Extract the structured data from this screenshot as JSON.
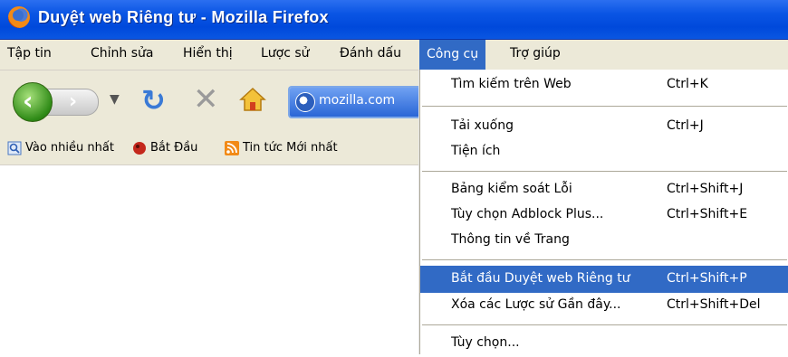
{
  "window": {
    "title": "Duyệt web Riêng tư - Mozilla Firefox"
  },
  "menubar": {
    "items": [
      "Tập tin",
      "Chỉnh sửa",
      "Hiển thị",
      "Lược sử",
      "Đánh dấu",
      "Công cụ",
      "Trợ giúp"
    ],
    "active": "Công cụ"
  },
  "navbar": {
    "url": "mozilla.com"
  },
  "bookmarks": {
    "items": [
      "Vào nhiều nhất",
      "Bắt Đầu",
      "Tin tức Mới nhất"
    ]
  },
  "tools_menu": {
    "items": [
      {
        "label": "Tìm kiếm trên Web",
        "shortcut": "Ctrl+K"
      },
      {
        "label": "Tải xuống",
        "shortcut": "Ctrl+J"
      },
      {
        "label": "Tiện ích",
        "shortcut": ""
      },
      {
        "label": "Bảng kiểm soát Lỗi",
        "shortcut": "Ctrl+Shift+J"
      },
      {
        "label": "Tùy chọn Adblock Plus...",
        "shortcut": "Ctrl+Shift+E"
      },
      {
        "label": "Thông tin về Trang",
        "shortcut": ""
      },
      {
        "label": "Bắt đầu Duyệt web Riêng tư",
        "shortcut": "Ctrl+Shift+P"
      },
      {
        "label": "Xóa các Lược sử Gần đây...",
        "shortcut": "Ctrl+Shift+Del"
      },
      {
        "label": "Tùy chọn...",
        "shortcut": ""
      }
    ],
    "highlighted": "Bắt đầu Duyệt web Riêng tư"
  },
  "colors": {
    "title_bar": "#0a55e4",
    "menu_highlight": "#316ac5",
    "chrome": "#ece9d8"
  }
}
